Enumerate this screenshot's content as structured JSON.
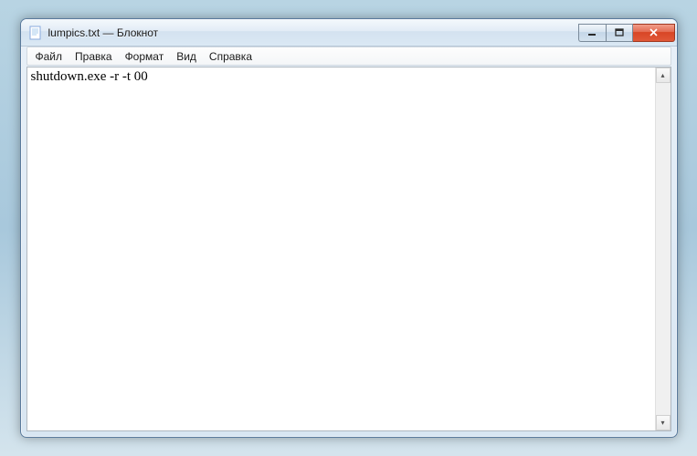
{
  "window": {
    "title": "lumpics.txt — Блокнот"
  },
  "menu": {
    "file": "Файл",
    "edit": "Правка",
    "format": "Формат",
    "view": "Вид",
    "help": "Справка"
  },
  "editor": {
    "content": "shutdown.exe -r -t 00"
  },
  "icons": {
    "min_glyph": "—",
    "close_glyph": "✕",
    "scroll_up": "▴",
    "scroll_down": "▾"
  }
}
